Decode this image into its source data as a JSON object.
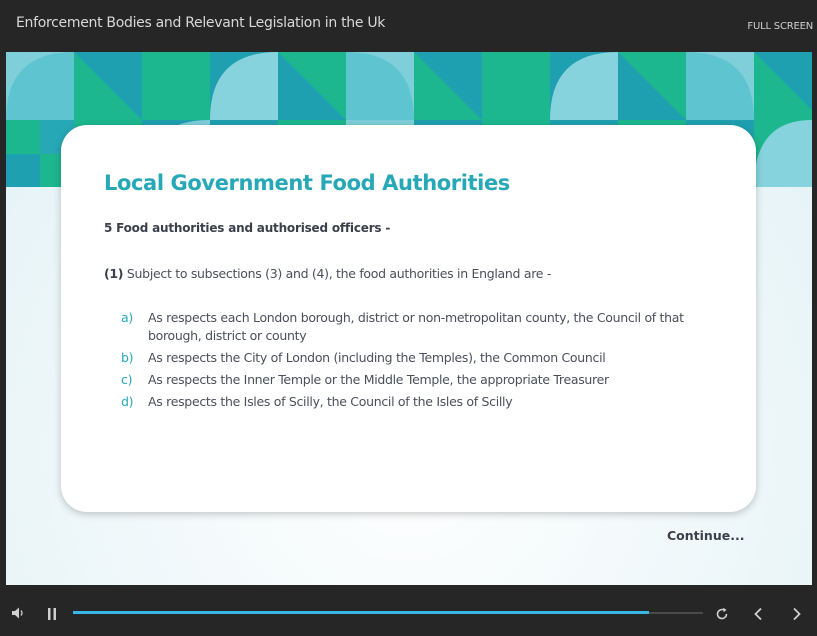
{
  "header": {
    "course_title": "Enforcement Bodies and Relevant Legislation in the Uk",
    "fullscreen_label": "FULL SCREEN"
  },
  "slide": {
    "title": "Local Government Food Authorities",
    "section_heading": "5 Food authorities and authorised officers -",
    "subsection_number": "(1)",
    "subsection_text": "Subject to subsections (3) and (4), the food authorities in England are -",
    "items": [
      {
        "marker": "a)",
        "text": "As respects each London borough, district or non-metropolitan county, the Council of that borough, district or county"
      },
      {
        "marker": "b)",
        "text": "As respects the City of London (including the Temples), the Common Council"
      },
      {
        "marker": "c)",
        "text": "As respects the Inner Temple or the Middle Temple, the appropriate Treasurer"
      },
      {
        "marker": "d)",
        "text": "As respects the Isles of Scilly, the Council of the Isles of Scilly"
      }
    ],
    "continue_label": "Continue..."
  },
  "player": {
    "progress": 0.915,
    "icons": [
      "volume-icon",
      "pause-icon",
      "replay-icon",
      "previous-icon",
      "next-icon"
    ]
  },
  "colors": {
    "accent": "#27a8b6",
    "progress": "#38b6e6",
    "banner_teal": "#1fa0b0",
    "banner_green": "#1cb78e",
    "banner_light": "#7fd0dc"
  }
}
